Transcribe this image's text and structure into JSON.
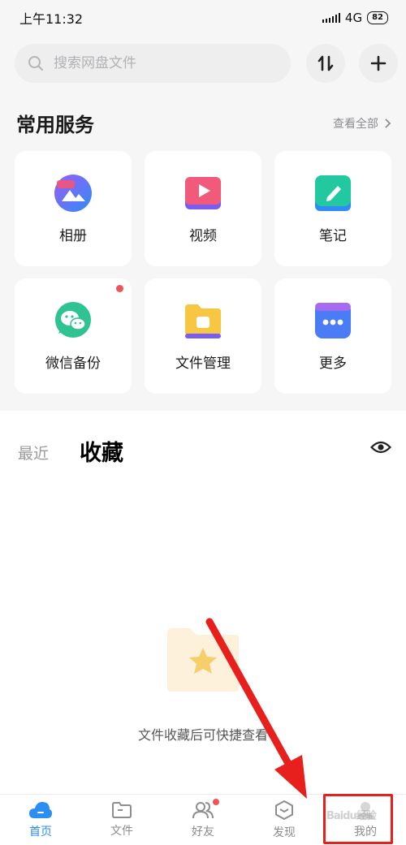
{
  "status_bar": {
    "time": "上午11:32",
    "network": "4G",
    "battery": "82"
  },
  "search": {
    "placeholder": "搜索网盘文件"
  },
  "services": {
    "title": "常用服务",
    "see_all": "查看全部",
    "items": [
      {
        "label": "相册",
        "icon": "album-icon"
      },
      {
        "label": "视频",
        "icon": "video-icon"
      },
      {
        "label": "笔记",
        "icon": "note-icon"
      },
      {
        "label": "微信备份",
        "icon": "wechat-backup-icon"
      },
      {
        "label": "文件管理",
        "icon": "file-manager-icon"
      },
      {
        "label": "更多",
        "icon": "more-icon"
      }
    ]
  },
  "tabs": {
    "recent": "最近",
    "favorites": "收藏"
  },
  "empty_state": {
    "text": "文件收藏后可快捷查看"
  },
  "nav": {
    "items": [
      {
        "label": "首页",
        "icon": "home-cloud-icon"
      },
      {
        "label": "文件",
        "icon": "folder-icon"
      },
      {
        "label": "好友",
        "icon": "friends-icon"
      },
      {
        "label": "发现",
        "icon": "discover-icon"
      },
      {
        "label": "我的",
        "icon": "profile-icon"
      }
    ]
  },
  "watermark": "Baidu经验",
  "colors": {
    "accent": "#2b8ef0",
    "annotation": "#e8201d",
    "badge": "#f0535a"
  }
}
